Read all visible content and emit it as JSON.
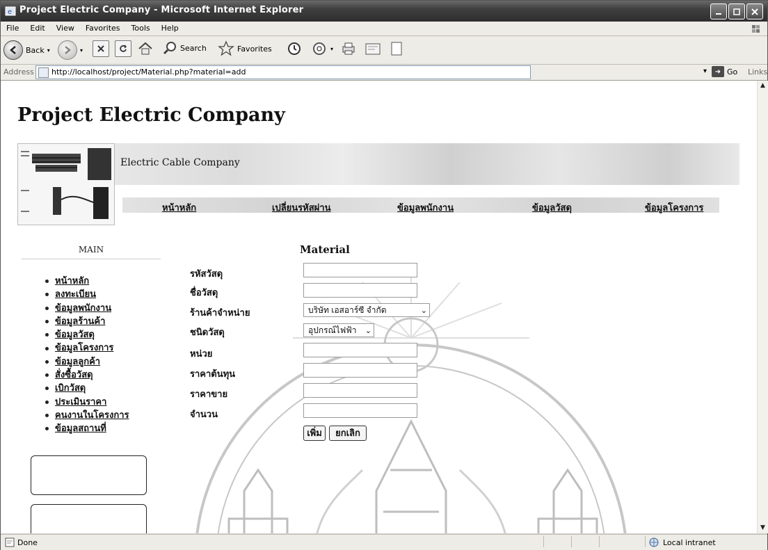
{
  "window": {
    "title": "Project Electric Company - Microsoft Internet Explorer"
  },
  "menu": [
    "File",
    "Edit",
    "View",
    "Favorites",
    "Tools",
    "Help"
  ],
  "toolbar": {
    "back_label": "Back",
    "search_label": "Search",
    "favorites_label": "Favorites"
  },
  "address": {
    "label": "Address",
    "url": "http://localhost/project/Material.php?material=add",
    "go_label": "Go",
    "links_label": "Links"
  },
  "page": {
    "title": "Project Electric Company",
    "banner_text": "Electric Cable Company",
    "nav": [
      "หน้าหลัก",
      "เปลี่ยนรหัสผ่าน",
      "ข้อมูลพนักงาน",
      "ข้อมูลวัสดุ",
      "ข้อมูลโครงการ"
    ],
    "sidebar_heading": "MAIN",
    "sidebar_items": [
      "หน้าหลัก",
      "ลงทะเบียน",
      "ข้อมูลพนักงาน",
      "ข้อมูลร้านค้า",
      "ข้อมูลวัสดุ",
      "ข้อมูลโครงการ",
      "ข้อมูลลูกค้า",
      "สั่งซื้อวัสดุ",
      "เบิกวัสดุ",
      "ประเมินราคา",
      "คนงานในโครงการ",
      "ข้อมูลสถานที่"
    ]
  },
  "form": {
    "title": "Material",
    "labels": [
      "รหัสวัสดุ",
      "ชื่อวัสดุ",
      "ร้านค้าจำหน่าย",
      "ชนิดวัสดุ",
      "หน่วย",
      "ราคาต้นทุน",
      "ราคาขาย",
      "จำนวน"
    ],
    "supplier_value": "บริษัท เอสอาร์ซี จำกัด",
    "type_value": "อุปกรณ์ไฟฟ้า",
    "add_button": "เพิ่ม",
    "cancel_button": "ยกเลิก"
  },
  "status": {
    "left": "Done",
    "zone": "Local intranet"
  }
}
